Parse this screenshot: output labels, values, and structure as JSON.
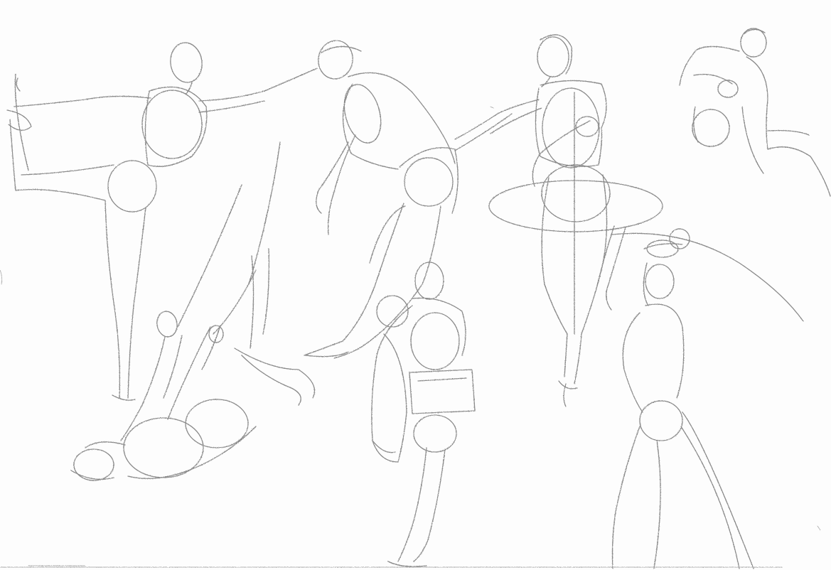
{
  "paper": {
    "background": "#fdfdfd",
    "pencil_color": "#8a8a8a",
    "pencil_color_light": "#b4b4b4"
  },
  "figures": [
    {
      "pose": "standing-one-leg-raised"
    },
    {
      "pose": "bending-forward"
    },
    {
      "pose": "standing-arm-extended"
    },
    {
      "pose": "crouching"
    },
    {
      "pose": "reclining-on-floor"
    },
    {
      "pose": "standing-holding-book"
    },
    {
      "pose": "standing-arm-raised-with-staff"
    }
  ]
}
